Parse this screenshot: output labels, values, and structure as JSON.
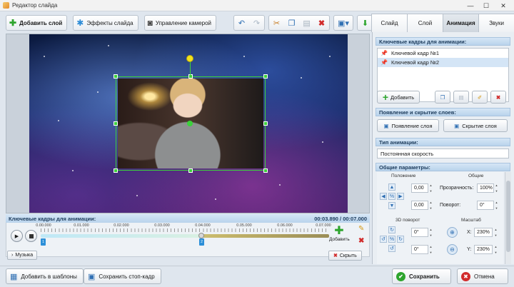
{
  "window": {
    "title": "Редактор слайда",
    "minimize": "—",
    "maximize": "☐",
    "close": "✕"
  },
  "toolbar": {
    "add_layer": "Добавить слой",
    "slide_effects": "Эффекты слайда",
    "camera_control": "Управление камерой"
  },
  "tabs": [
    "Слайд",
    "Слой",
    "Анимация",
    "Звуки"
  ],
  "active_tab": "Анимация",
  "keyframes_panel": {
    "title": "Ключевые кадры для анимации:",
    "items": [
      "Ключевой кадр №1",
      "Ключевой кадр №2"
    ],
    "selected_index": 1,
    "add_label": "Добавить"
  },
  "appear_section": {
    "title": "Появление и скрытие слоев:",
    "appear_label": "Появление слоя",
    "hide_label": "Скрытие слоя"
  },
  "anim_type": {
    "title": "Тип анимации:",
    "value": "Постоянная скорость"
  },
  "general": {
    "title": "Общие параметры:",
    "position_title": "Положение",
    "position_x": "0,00",
    "position_y": "0,00",
    "common_title": "Общие",
    "transparency_label": "Прозрачность:",
    "transparency_value": "100%",
    "rotation_label": "Поворот:",
    "rotation_value": "0°",
    "rotation3d_title": "3D поворот",
    "rot3d_1": "0°",
    "rot3d_2": "0°",
    "scale_title": "Масштаб",
    "scale_x_label": "X:",
    "scale_x_value": "230%",
    "scale_y_label": "Y:",
    "scale_y_value": "230%"
  },
  "timeline": {
    "title": "Ключевые кадры для анимации:",
    "time": "00:03.890 / 00:07.000",
    "ticks": [
      "0.00.000",
      "0.01.000",
      "0.02.000",
      "0.03.000",
      "0.04.000",
      "0.05.000",
      "0.06.000",
      "0.07.000"
    ],
    "keyframe_markers": [
      "1",
      "2"
    ],
    "playhead_fraction": 0.556,
    "add_label": "Добавить",
    "music_label": "Музыка",
    "hide_label": "Скрыть"
  },
  "bottom": {
    "add_template": "Добавить в шаблоны",
    "save_frame": "Сохранить стоп-кадр",
    "save": "Сохранить",
    "cancel": "Отмена"
  },
  "colors": {
    "accent": "#3bd13b",
    "selection": "#d4e5f6",
    "header": "#b9d3ec"
  }
}
